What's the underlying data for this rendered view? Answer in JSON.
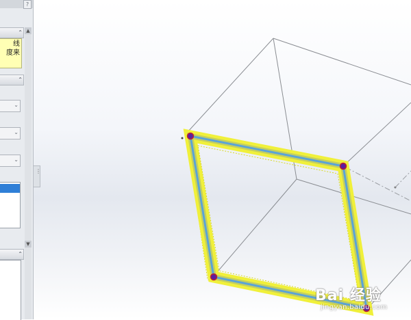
{
  "property_manager": {
    "help_button": "?",
    "message_section": {
      "collapse_glyph": "⌃",
      "lines": [
        "线",
        "度来"
      ]
    },
    "selection_section": {
      "collapse_glyph": "⌃"
    },
    "lower_section": {
      "collapse_glyph": "⌃"
    },
    "combo_arrow_glyph": "⌄",
    "scroll_up_glyph": "▲",
    "scroll_down_glyph": "▼"
  },
  "splitter": {
    "glyph": "⋮"
  },
  "watermark": {
    "brand": "Bai 经验",
    "url": "jingyan.baidu.com"
  },
  "colors": {
    "highlight_yellow": "#f0f03a",
    "highlight_blue": "#5aa3d8",
    "edge_gray": "#8a8d92",
    "vertex_purple": "#5a1ea0",
    "vertex_red": "#c02030"
  }
}
